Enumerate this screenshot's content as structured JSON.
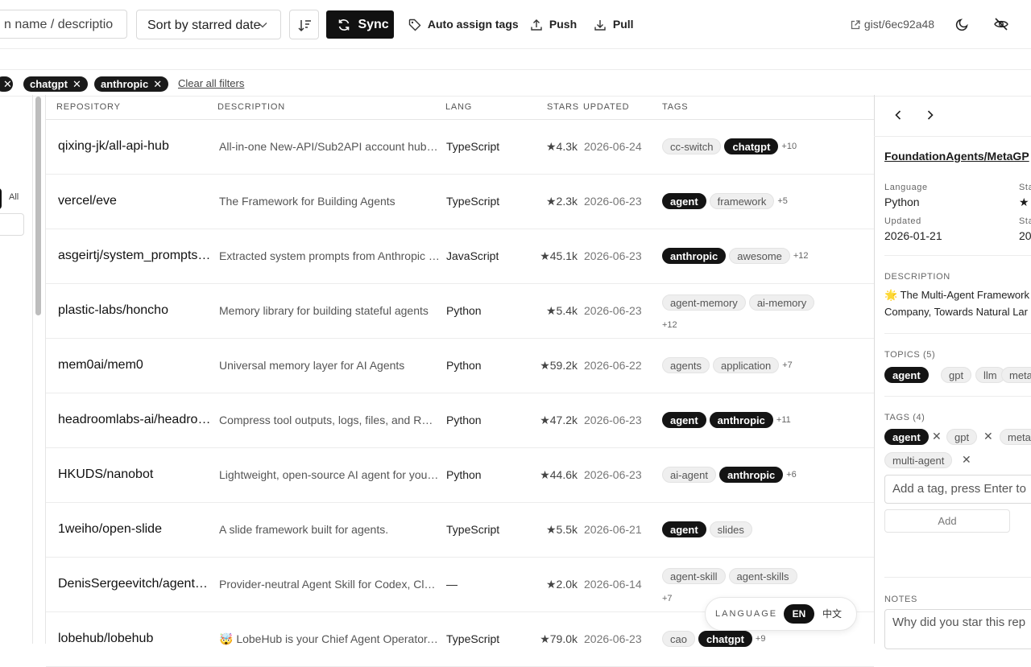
{
  "toolbar": {
    "search_placeholder": "n name / descriptio",
    "sort_value": "Sort by starred date",
    "sync_label": "Sync",
    "auto_tag_label": "Auto assign tags",
    "push_label": "Push",
    "pull_label": "Pull",
    "gist_label": "gist/6ec92a48"
  },
  "filters": {
    "chips": [
      "chatgpt",
      "anthropic"
    ],
    "clear_label": "Clear all filters"
  },
  "sidebar": {
    "all_label": "All"
  },
  "table": {
    "headers": {
      "repo": "REPOSITORY",
      "desc": "DESCRIPTION",
      "lang": "LANG",
      "stars": "STARS",
      "updated": "UPDATED",
      "tags": "TAGS"
    },
    "rows": [
      {
        "repo": "qixing-jk/all-api-hub",
        "desc": "All-in-one New-API/Sub2API account hub: …",
        "lang": "TypeScript",
        "stars": "4.3k",
        "updated": "2026-06-24",
        "tags": [
          {
            "t": "cc-switch",
            "dark": false
          },
          {
            "t": "chatgpt",
            "dark": true
          }
        ],
        "more": "+10"
      },
      {
        "repo": "vercel/eve",
        "desc": "The Framework for Building Agents",
        "lang": "TypeScript",
        "stars": "2.3k",
        "updated": "2026-06-23",
        "tags": [
          {
            "t": "agent",
            "dark": true
          },
          {
            "t": "framework",
            "dark": false
          }
        ],
        "more": "+5"
      },
      {
        "repo": "asgeirtj/system_prompts_…",
        "desc": "Extracted system prompts from Anthropic -…",
        "lang": "JavaScript",
        "stars": "45.1k",
        "updated": "2026-06-23",
        "tags": [
          {
            "t": "anthropic",
            "dark": true
          },
          {
            "t": "awesome",
            "dark": false
          }
        ],
        "more": "+12"
      },
      {
        "repo": "plastic-labs/honcho",
        "desc": "Memory library for building stateful agents",
        "lang": "Python",
        "stars": "5.4k",
        "updated": "2026-06-23",
        "tags": [
          {
            "t": "agent-memory",
            "dark": false
          },
          {
            "t": "ai-memory",
            "dark": false
          }
        ],
        "more": "+12"
      },
      {
        "repo": "mem0ai/mem0",
        "desc": "Universal memory layer for AI Agents",
        "lang": "Python",
        "stars": "59.2k",
        "updated": "2026-06-22",
        "tags": [
          {
            "t": "agents",
            "dark": false
          },
          {
            "t": "application",
            "dark": false
          }
        ],
        "more": "+7"
      },
      {
        "repo": "headroomlabs-ai/headroom",
        "desc": "Compress tool outputs, logs, files, and RAG…",
        "lang": "Python",
        "stars": "47.2k",
        "updated": "2026-06-23",
        "tags": [
          {
            "t": "agent",
            "dark": true
          },
          {
            "t": "anthropic",
            "dark": true
          }
        ],
        "more": "+11"
      },
      {
        "repo": "HKUDS/nanobot",
        "desc": "Lightweight, open-source AI agent for your …",
        "lang": "Python",
        "stars": "44.6k",
        "updated": "2026-06-23",
        "tags": [
          {
            "t": "ai-agent",
            "dark": false
          },
          {
            "t": "anthropic",
            "dark": true
          }
        ],
        "more": "+6"
      },
      {
        "repo": "1weiho/open-slide",
        "desc": "A slide framework built for agents.",
        "lang": "TypeScript",
        "stars": "5.5k",
        "updated": "2026-06-21",
        "tags": [
          {
            "t": "agent",
            "dark": true
          },
          {
            "t": "slides",
            "dark": false
          }
        ],
        "more": ""
      },
      {
        "repo": "DenisSergeevitch/agents-…",
        "desc": "Provider-neutral Agent Skill for Codex, Clau…",
        "lang": "—",
        "stars": "2.0k",
        "updated": "2026-06-14",
        "tags": [
          {
            "t": "agent-skill",
            "dark": false
          },
          {
            "t": "agent-skills",
            "dark": false
          }
        ],
        "more": "+7"
      },
      {
        "repo": "lobehub/lobehub",
        "desc": "🤯 LobeHub is your Chief Agent Operator, o…",
        "lang": "TypeScript",
        "stars": "79.0k",
        "updated": "2026-06-23",
        "tags": [
          {
            "t": "cao",
            "dark": false
          },
          {
            "t": "chatgpt",
            "dark": true
          }
        ],
        "more": "+9"
      }
    ]
  },
  "panel": {
    "repo_title": "FoundationAgents/MetaGP",
    "language_label": "Language",
    "language_value": "Python",
    "stars_label": "Sta",
    "updated_label": "Updated",
    "updated_value": "2026-01-21",
    "status_label": "Sta",
    "status_value": "20",
    "description_label": "DESCRIPTION",
    "description_line1": "🌟 The Multi-Agent Framework",
    "description_line2": "Company, Towards Natural Lar",
    "topics_label": "TOPICS (5)",
    "topics": [
      {
        "t": "agent",
        "dark": true
      },
      {
        "t": "gpt",
        "dark": false
      },
      {
        "t": "llm",
        "dark": false
      },
      {
        "t": "meta",
        "dark": false
      }
    ],
    "tags_label": "TAGS (4)",
    "tags": [
      "agent",
      "gpt",
      "meta",
      "multi-agent"
    ],
    "add_tag_placeholder": "Add a tag, press Enter to",
    "add_label": "Add",
    "notes_label": "NOTES",
    "notes_placeholder": "Why did you star this rep"
  },
  "language_toggle": {
    "label": "LANGUAGE",
    "en": "EN",
    "zh": "中文"
  }
}
